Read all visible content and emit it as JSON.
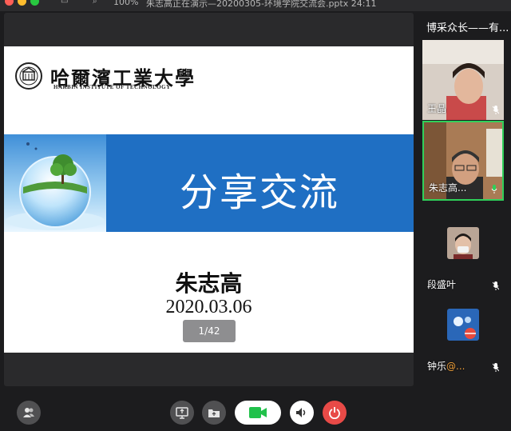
{
  "window": {
    "zoom": "100%",
    "title": "朱志高正在演示—20200305-环境学院交流会.pptx 24:11"
  },
  "slide": {
    "university_cn": "哈爾濱工業大學",
    "university_en": "HARBIN INSTITUTE OF TECHNOLOGY",
    "banner_title": "分享交流",
    "author": "朱志高",
    "date": "2020.03.06",
    "page_indicator": "1/42",
    "banner_color": "#1f6fc3"
  },
  "sidebar": {
    "title": "博采众长——有...",
    "participants": [
      {
        "name": "王晶",
        "mic": "muted"
      },
      {
        "name": "朱志高...",
        "mic": "speaking"
      },
      {
        "name": "段盛叶",
        "mic": "muted"
      },
      {
        "name": "钟乐",
        "badge": "@...",
        "mic": "muted"
      }
    ]
  },
  "controls": {
    "participants_icon": "participants-icon",
    "share_screen_icon": "share-screen-icon",
    "folder_icon": "folder-icon",
    "video_icon": "video-camera-icon",
    "audio_icon": "speaker-icon",
    "end_icon": "power-icon",
    "video_color": "#21c14b",
    "end_color": "#e84a47"
  }
}
